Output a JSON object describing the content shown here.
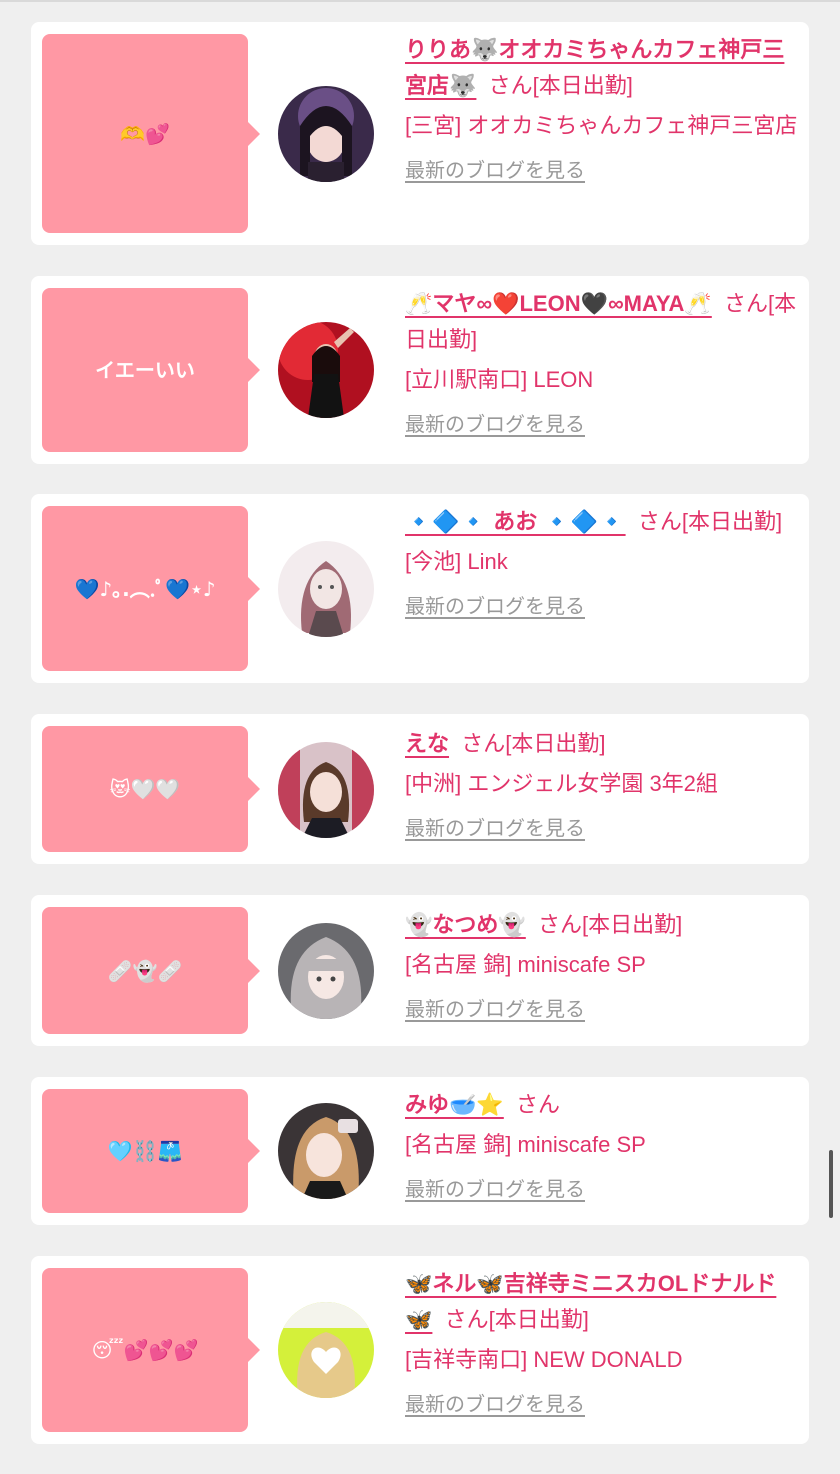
{
  "accent_color": "#e1346a",
  "bubble_color": "#ff98a4",
  "blog_link_color": "#999999",
  "entries": [
    {
      "message": "🫶💕",
      "name": "りりあ🐺オオカミちゃんカフェ神戸三宮店🐺",
      "suffix": "さん[本日出勤]",
      "shop": "[三宮] オオカミちゃんカフェ神戸三宮店",
      "blog_link": "最新のブログを見る"
    },
    {
      "message": "イエーいい",
      "name": "🥂マヤ∞❤️LEON🖤∞MAYA🥂",
      "suffix": "さん[本日出勤]",
      "shop": "[立川駅南口] LEON",
      "blog_link": "最新のブログを見る"
    },
    {
      "message": "💙♪｡.︵.ﾟ💙⋆♪",
      "name": "🔹🔷🔹 あお 🔹🔷🔹",
      "suffix": "さん[本日出勤]",
      "shop": "[今池] Link",
      "blog_link": "最新のブログを見る"
    },
    {
      "message": "😻🤍🤍",
      "name": "えな",
      "suffix": "さん[本日出勤]",
      "shop": "[中洲] エンジェル女学園 3年2組",
      "blog_link": "最新のブログを見る"
    },
    {
      "message": "🩹👻🩹",
      "name": "👻なつめ👻",
      "suffix": "さん[本日出勤]",
      "shop": "[名古屋 錦] miniscafe SP",
      "blog_link": "最新のブログを見る"
    },
    {
      "message": "🩵⛓️🩳",
      "name": "みゆ🥣⭐️",
      "suffix": "さん",
      "shop": "[名古屋 錦] miniscafe SP",
      "blog_link": "最新のブログを見る"
    },
    {
      "message": "😴💕💕💕",
      "name": "🦋ネル🦋吉祥寺ミニスカOLドナルド🦋",
      "suffix": "さん[本日出勤]",
      "shop": "[吉祥寺南口] NEW DONALD",
      "blog_link": "最新のブログを見る"
    }
  ]
}
